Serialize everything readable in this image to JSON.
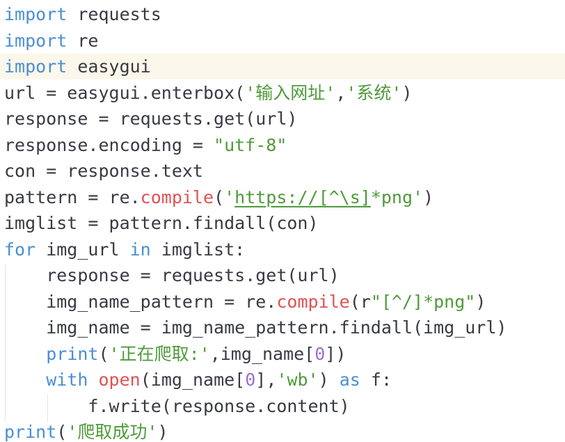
{
  "editor": {
    "active_line": 2,
    "lines": [
      [
        {
          "t": "import",
          "c": "kw"
        },
        {
          "t": " requests"
        }
      ],
      [
        {
          "t": "import",
          "c": "kw"
        },
        {
          "t": " re"
        }
      ],
      [
        {
          "t": "import",
          "c": "kw"
        },
        {
          "t": " easygui"
        }
      ],
      [
        {
          "t": "url = easygui.enterbox("
        },
        {
          "t": "'输入网址'",
          "c": "str"
        },
        {
          "t": ","
        },
        {
          "t": "'系统'",
          "c": "str"
        },
        {
          "t": ")"
        }
      ],
      [
        {
          "t": "response = requests.get(url)"
        }
      ],
      [
        {
          "t": "response.encoding = "
        },
        {
          "t": "\"utf-8\"",
          "c": "str"
        }
      ],
      [
        {
          "t": "con = response.text"
        }
      ],
      [
        {
          "t": "pattern = re."
        },
        {
          "t": "compile",
          "c": "fn"
        },
        {
          "t": "("
        },
        {
          "t": "'",
          "c": "str"
        },
        {
          "t": "https://[^\\s]",
          "c": "str",
          "u": true
        },
        {
          "t": "*png'",
          "c": "str"
        },
        {
          "t": ")"
        }
      ],
      [
        {
          "t": "imglist = pattern.findall(con)"
        }
      ],
      [
        {
          "t": "for",
          "c": "kw"
        },
        {
          "t": " img_url "
        },
        {
          "t": "in",
          "c": "kw"
        },
        {
          "t": " imglist:"
        }
      ],
      [
        {
          "t": "    response = requests.get(url)"
        }
      ],
      [
        {
          "t": "    img_name_pattern = re."
        },
        {
          "t": "compile",
          "c": "fn"
        },
        {
          "t": "(r"
        },
        {
          "t": "\"[^/]*png\"",
          "c": "str"
        },
        {
          "t": ")"
        }
      ],
      [
        {
          "t": "    img_name = img_name_pattern.findall(img_url)"
        }
      ],
      [
        {
          "t": "    "
        },
        {
          "t": "print",
          "c": "kw"
        },
        {
          "t": "("
        },
        {
          "t": "'正在爬取:'",
          "c": "str"
        },
        {
          "t": ",img_name["
        },
        {
          "t": "0",
          "c": "num"
        },
        {
          "t": "])"
        }
      ],
      [
        {
          "t": "    "
        },
        {
          "t": "with",
          "c": "kw"
        },
        {
          "t": " "
        },
        {
          "t": "open",
          "c": "fn"
        },
        {
          "t": "(img_name["
        },
        {
          "t": "0",
          "c": "num"
        },
        {
          "t": "],"
        },
        {
          "t": "'wb'",
          "c": "str"
        },
        {
          "t": ") "
        },
        {
          "t": "as",
          "c": "kw"
        },
        {
          "t": " f:"
        }
      ],
      [
        {
          "t": "        f.write(response.content)"
        }
      ],
      [
        {
          "t": "print",
          "c": "kw"
        },
        {
          "t": "("
        },
        {
          "t": "'爬取成功'",
          "c": "str"
        },
        {
          "t": ")"
        }
      ]
    ]
  }
}
